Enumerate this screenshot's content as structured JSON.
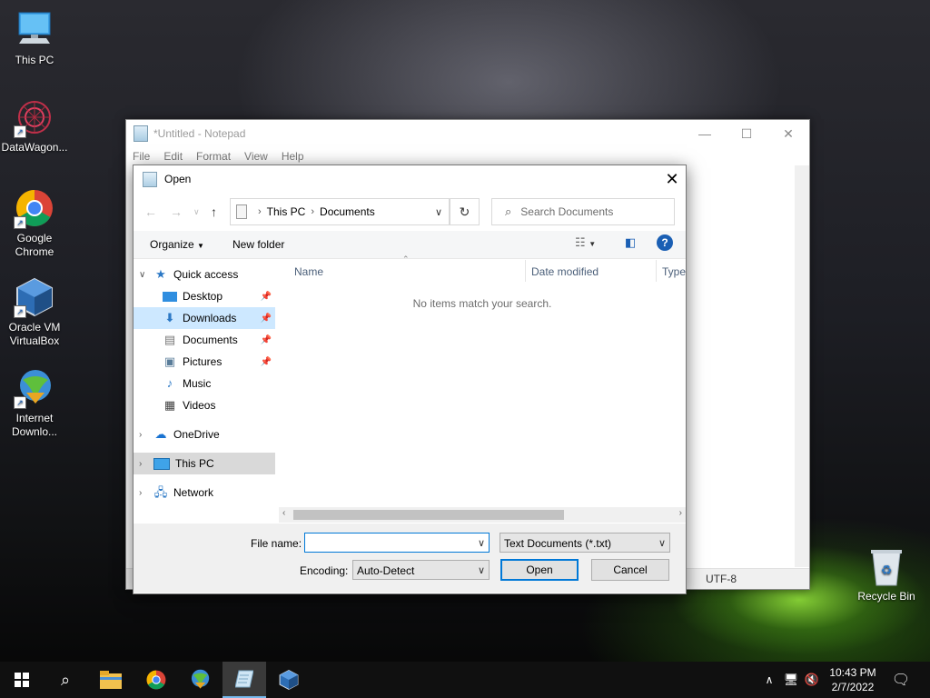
{
  "desktop": {
    "icons": [
      {
        "label": "This PC"
      },
      {
        "label": "DataWagon..."
      },
      {
        "label": "Google Chrome"
      },
      {
        "label": "Oracle VM VirtualBox"
      },
      {
        "label": "Internet Downlo..."
      }
    ],
    "recycle_bin": "Recycle Bin"
  },
  "notepad": {
    "title": "*Untitled - Notepad",
    "menu": [
      "File",
      "Edit",
      "Format",
      "View",
      "Help"
    ],
    "encoding_status": "UTF-8"
  },
  "dialog": {
    "title": "Open",
    "address": {
      "segments": [
        "This PC",
        "Documents"
      ]
    },
    "search_placeholder": "Search Documents",
    "commands": {
      "organize": "Organize",
      "new_folder": "New folder"
    },
    "nav": {
      "quick_access": "Quick access",
      "items": [
        "Desktop",
        "Downloads",
        "Documents",
        "Pictures",
        "Music",
        "Videos"
      ],
      "onedrive": "OneDrive",
      "this_pc": "This PC",
      "network": "Network"
    },
    "columns": [
      "Name",
      "Date modified",
      "Type"
    ],
    "empty_message": "No items match your search.",
    "file_name_label": "File name:",
    "file_name_value": "",
    "file_type": "Text Documents (*.txt)",
    "encoding_label": "Encoding:",
    "encoding_value": "Auto-Detect",
    "open_button": "Open",
    "cancel_button": "Cancel"
  },
  "taskbar": {
    "time": "10:43 PM",
    "date": "2/7/2022"
  },
  "colors": {
    "accent": "#0078d7",
    "selection": "#cde8ff"
  }
}
